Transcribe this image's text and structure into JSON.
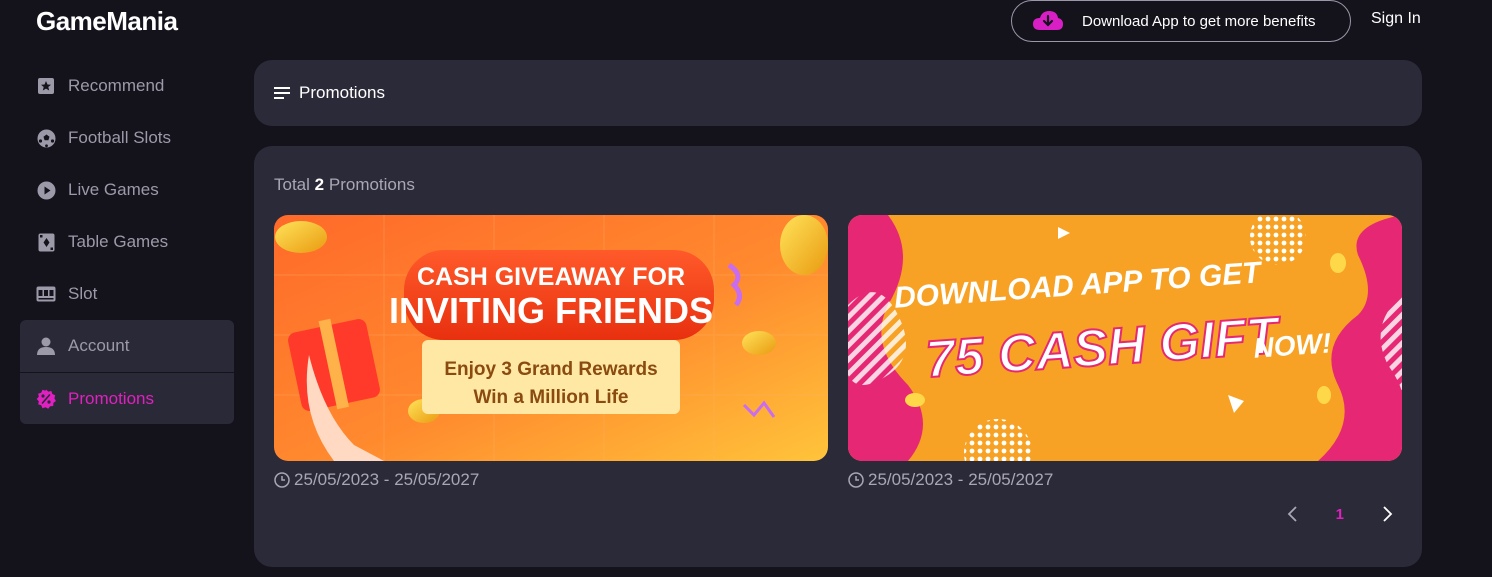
{
  "header": {
    "logo": "GameMania",
    "download_label": "Download App to get more benefits",
    "signin_label": "Sign In"
  },
  "sidebar": {
    "items": [
      {
        "label": "Recommend",
        "icon": "star-badge-icon"
      },
      {
        "label": "Football Slots",
        "icon": "football-icon"
      },
      {
        "label": "Live Games",
        "icon": "play-icon"
      },
      {
        "label": "Table Games",
        "icon": "card-icon"
      },
      {
        "label": "Slot",
        "icon": "slot-machine-icon"
      },
      {
        "label": "Account",
        "icon": "user-icon"
      },
      {
        "label": "Promotions",
        "icon": "promo-badge-icon",
        "active": true
      }
    ]
  },
  "main": {
    "section_title": "Promotions",
    "total_prefix": "Total",
    "total_count": "2",
    "total_suffix": "Promotions",
    "promotions": [
      {
        "banner_line1": "CASH GIVEAWAY FOR",
        "banner_line2": "INVITING FRIENDS",
        "banner_line3": "Enjoy 3 Grand Rewards",
        "banner_line4": "Win a Million Life",
        "date": "25/05/2023 - 25/05/2027"
      },
      {
        "banner_line1": "DOWNLOAD APP TO GET",
        "banner_line2": "75 CASH GIFT",
        "banner_line3": "NOW!",
        "date": "25/05/2023 - 25/05/2027"
      }
    ],
    "pagination": {
      "current": "1"
    }
  },
  "colors": {
    "background": "#14131c",
    "panel": "#2b2a39",
    "accent": "#e020c0",
    "muted_text": "#a9a7b4"
  }
}
